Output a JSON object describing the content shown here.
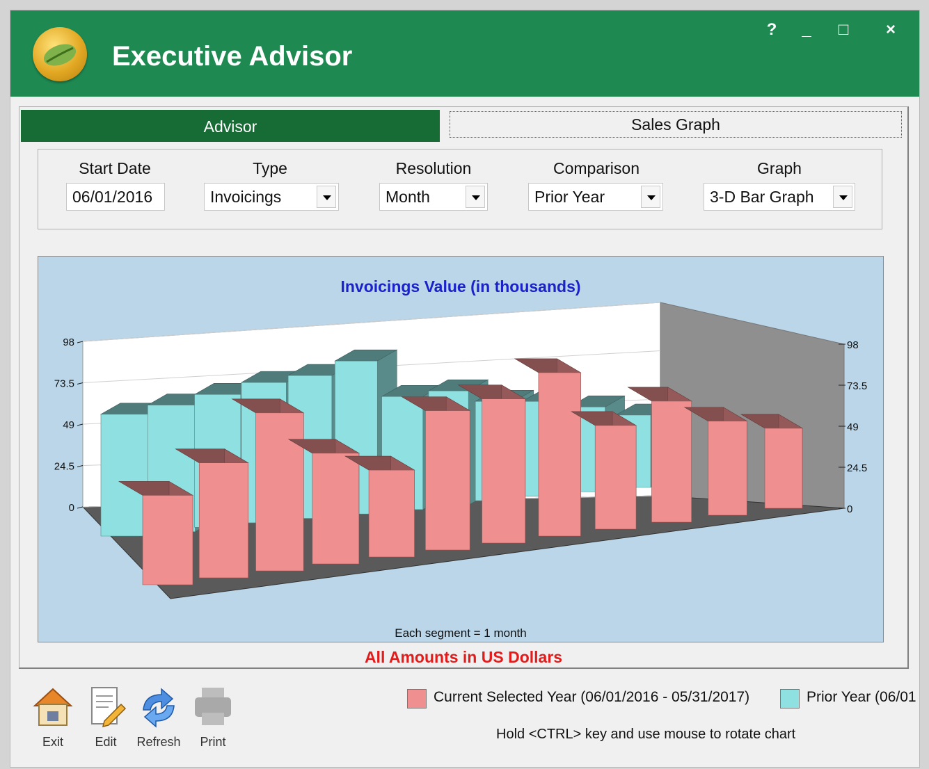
{
  "app": {
    "title": "Executive Advisor",
    "controls": {
      "help": "?",
      "minimize": "_",
      "maximize": "□",
      "close": "×"
    }
  },
  "tabs": [
    {
      "label": "Advisor",
      "active": true
    },
    {
      "label": "Sales Graph",
      "active": false
    }
  ],
  "filters": {
    "start_date": {
      "label": "Start Date",
      "value": "06/01/2016"
    },
    "type": {
      "label": "Type",
      "value": "Invoicings"
    },
    "resolution": {
      "label": "Resolution",
      "value": "Month"
    },
    "comparison": {
      "label": "Comparison",
      "value": "Prior Year"
    },
    "graph": {
      "label": "Graph",
      "value": "3-D Bar Graph"
    }
  },
  "chart_data": {
    "type": "bar",
    "title": "Invoicings Value (in thousands)",
    "xlabel": "Each segment = 1 month",
    "ylim": [
      0,
      98
    ],
    "yticks": [
      "0",
      "24.5",
      "49",
      "73.5",
      "98"
    ],
    "series": [
      {
        "name": "Current Selected Year (06/01/2016 - 05/31/2017)",
        "color": "#f08f8f",
        "values": [
          42,
          55,
          77,
          55,
          44,
          72,
          76,
          88,
          57,
          68,
          54,
          47
        ]
      },
      {
        "name": "Prior Year (06/01",
        "color": "#8fe0e0",
        "values": [
          74,
          78,
          83,
          89,
          92,
          100,
          75,
          77,
          68,
          66,
          60,
          52
        ]
      }
    ]
  },
  "notes": {
    "amounts": "All Amounts in US Dollars",
    "rotate_hint": "Hold <CTRL> key and use mouse to rotate chart"
  },
  "toolbar": {
    "exit": "Exit",
    "edit": "Edit",
    "refresh": "Refresh",
    "print": "Print"
  },
  "colors": {
    "titlebar": "#1e8a52",
    "active_tab": "#176b35",
    "chart_bg": "#bad6e8",
    "title_blue": "#1a22c8",
    "note_red": "#e21b1b"
  }
}
